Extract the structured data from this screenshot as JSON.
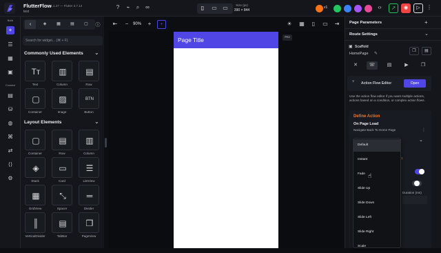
{
  "topbar": {
    "app_name": "FlutterFlow",
    "version": "v1.1.47 — Flutter 3.7.12",
    "project": "test",
    "size_label": "Size (px)",
    "size_value": "390 × 844",
    "branch": "v1"
  },
  "rail": {
    "build_label": "Build",
    "connect_label": "Connect"
  },
  "widgets": {
    "search_placeholder": "Search for widget... (⌘ + F)",
    "sections": [
      {
        "title": "Commonly Used Elements",
        "items": [
          "Text",
          "Column",
          "Row",
          "Container",
          "Image",
          "Button"
        ]
      },
      {
        "title": "Layout Elements",
        "items": [
          "Container",
          "Row",
          "Column",
          "Stack",
          "Card",
          "ListView",
          "GridView",
          "Spacer",
          "Divider",
          "VerticalDivider",
          "TabBar",
          "PageView"
        ]
      }
    ]
  },
  "canvas": {
    "zoom": "90%",
    "page_title": "Page Title",
    "badge": "PRO"
  },
  "right": {
    "page_parameters": "Page Parameters",
    "route_settings": "Route Settings",
    "scaffold_title": "Scaffold",
    "scaffold_name": "HomePage",
    "afe_label": "Action Flow Editor",
    "open_button": "Open",
    "afe_description": "Use the action flow editor if you want multiple actions, actions based on a condition, or complex action flows.",
    "define_action": "Define Action",
    "on_page_load": "On Page Load",
    "navigate_back": "Navigate Back To Home Page",
    "duration_label": "Duration (ms)",
    "dropdown_options": [
      "Default",
      "Instant",
      "Fade",
      "Slide Up",
      "Slide Down",
      "Slide Left",
      "Slide Right",
      "Scale"
    ],
    "selected_option": "Default",
    "accent_color": "#4f46e5",
    "define_color": "#f97316"
  }
}
